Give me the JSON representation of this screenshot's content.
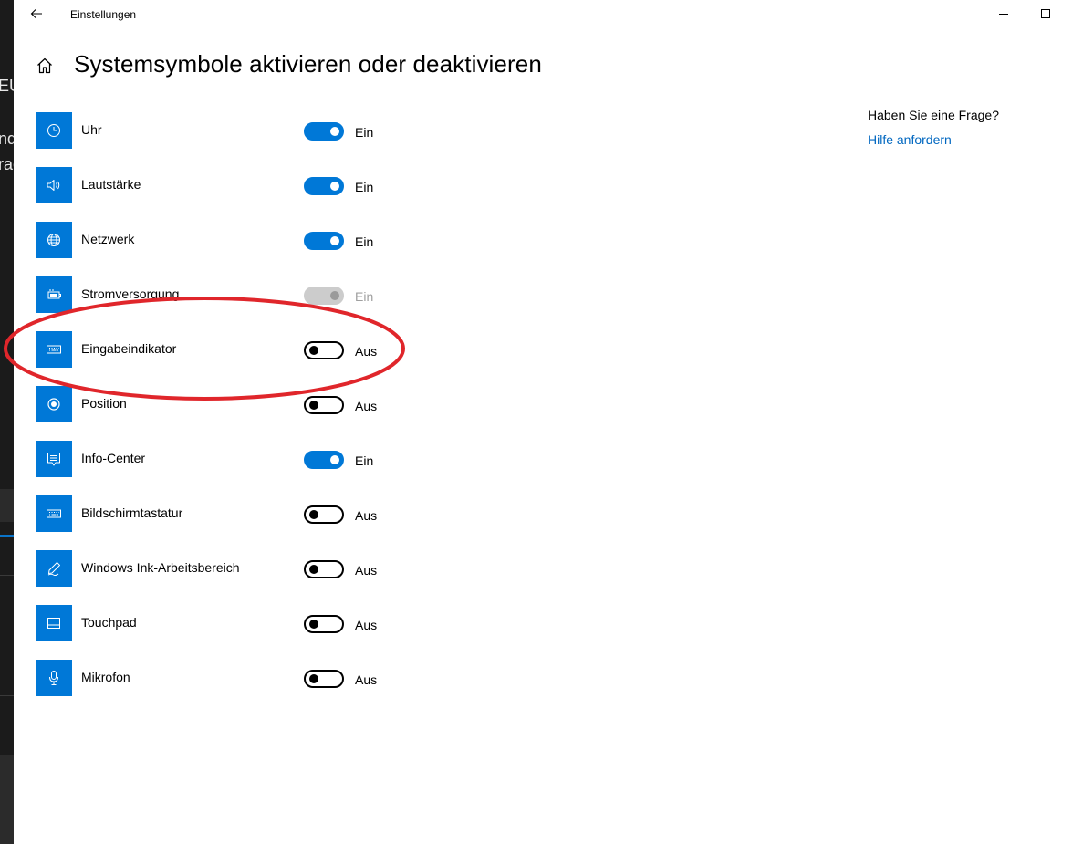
{
  "background_fragments": [
    "EU",
    "nd",
    "rac"
  ],
  "window": {
    "title": "Einstellungen",
    "back_icon": "arrow-left-icon",
    "minimize_icon": "minimize-icon",
    "maximize_icon": "maximize-icon"
  },
  "header": {
    "home_icon": "home-icon",
    "title": "Systemsymbole aktivieren oder deaktivieren"
  },
  "items": [
    {
      "label": "Uhr",
      "icon": "clock-icon",
      "state": "Ein",
      "toggle": "on"
    },
    {
      "label": "Lautstärke",
      "icon": "volume-icon",
      "state": "Ein",
      "toggle": "on"
    },
    {
      "label": "Netzwerk",
      "icon": "globe-icon",
      "state": "Ein",
      "toggle": "on"
    },
    {
      "label": "Stromversorgung",
      "icon": "battery-icon",
      "state": "Ein",
      "toggle": "disabled"
    },
    {
      "label": "Eingabeindikator",
      "icon": "keyboard-icon",
      "state": "Aus",
      "toggle": "off"
    },
    {
      "label": "Position",
      "icon": "location-icon",
      "state": "Aus",
      "toggle": "off"
    },
    {
      "label": "Info-Center",
      "icon": "action-center-icon",
      "state": "Ein",
      "toggle": "on"
    },
    {
      "label": "Bildschirmtastatur",
      "icon": "keyboard-icon",
      "state": "Aus",
      "toggle": "off"
    },
    {
      "label": "Windows Ink-Arbeitsbereich",
      "icon": "pen-icon",
      "state": "Aus",
      "toggle": "off"
    },
    {
      "label": "Touchpad",
      "icon": "touchpad-icon",
      "state": "Aus",
      "toggle": "off"
    },
    {
      "label": "Mikrofon",
      "icon": "microphone-icon",
      "state": "Aus",
      "toggle": "off"
    }
  ],
  "help": {
    "question": "Haben Sie eine Frage?",
    "link": "Hilfe anfordern"
  },
  "colors": {
    "accent": "#0078d7",
    "link": "#0067c0",
    "annotation": "#e0262b"
  }
}
